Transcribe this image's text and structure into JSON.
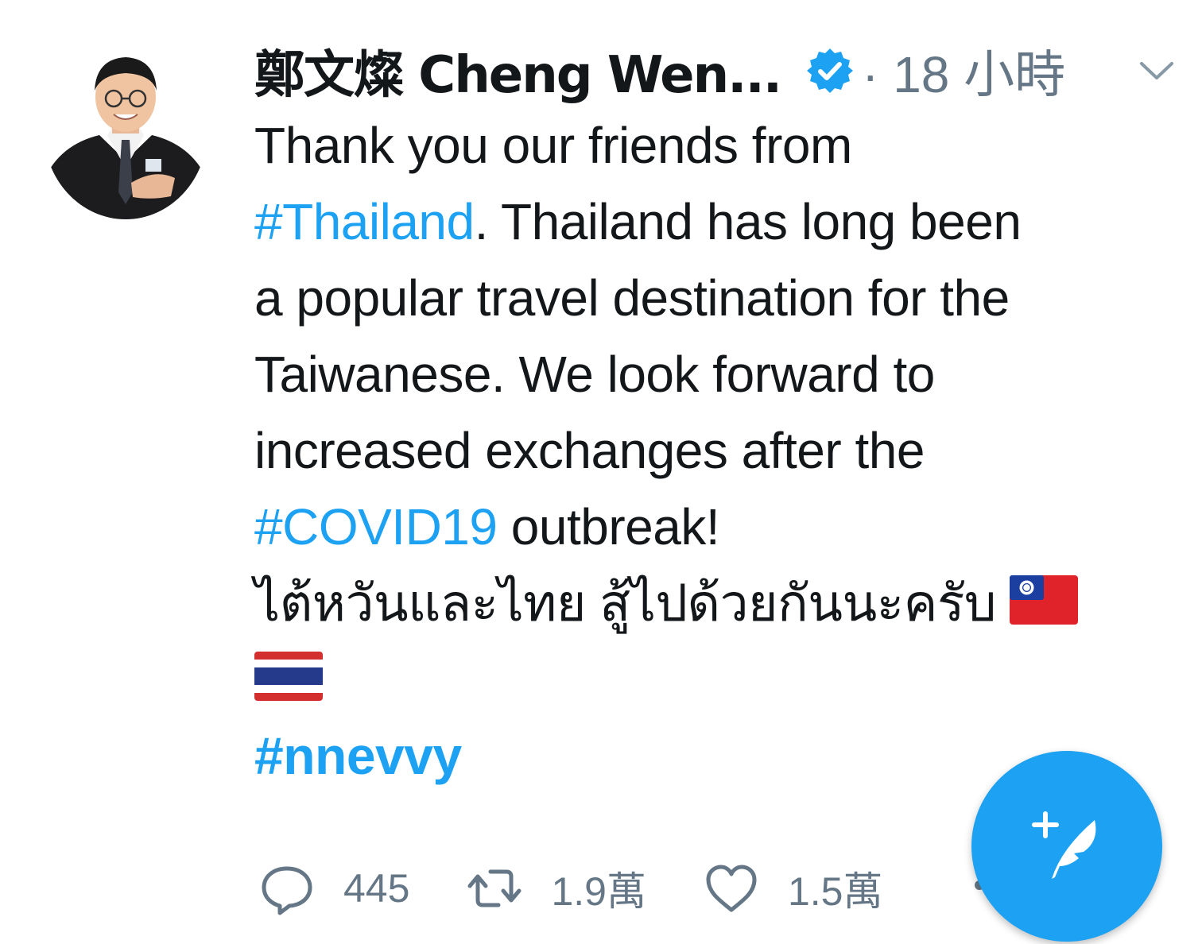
{
  "author": {
    "display_name": "鄭文燦 Cheng Wen...",
    "verified": true
  },
  "meta": {
    "separator": "·",
    "timestamp": "18 小時"
  },
  "tweet": {
    "line1": "Thank you our friends from",
    "hashtag_thailand": "#Thailand",
    "line2_rest": ". Thailand has long been",
    "line3": "a popular travel destination for the",
    "line4": "Taiwanese. We look forward to",
    "line5": "increased exchanges after the",
    "hashtag_covid": "#COVID19",
    "line6_rest": " outbreak!",
    "thai_line": "ไต้หวันและไทย สู้ไปด้วยกันนะครับ",
    "hashtag_nnevvy": "#nnevvy"
  },
  "actions": {
    "reply_count": "445",
    "retweet_count": "1.9萬",
    "like_count": "1.5萬"
  },
  "colors": {
    "accent": "#1da1f2",
    "muted": "#657786",
    "text": "#14171a"
  },
  "icons": {
    "verified": "verified-badge-icon",
    "chevron": "chevron-down-icon",
    "reply": "reply-icon",
    "retweet": "retweet-icon",
    "like": "heart-icon",
    "compose": "compose-tweet-icon"
  }
}
